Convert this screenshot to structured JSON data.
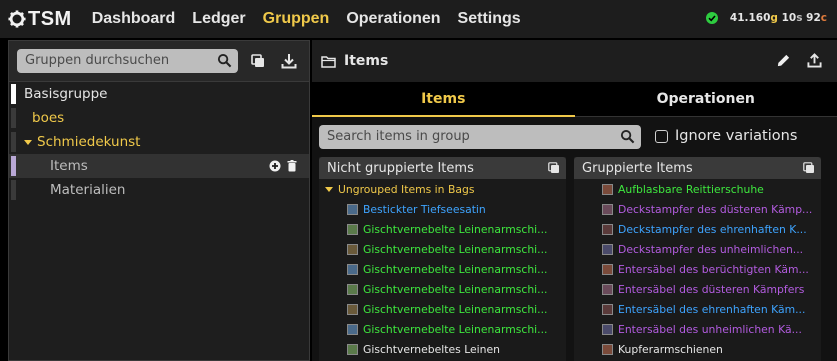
{
  "app": {
    "name": "TSM"
  },
  "nav": [
    {
      "label": "Dashboard",
      "active": false
    },
    {
      "label": "Ledger",
      "active": false
    },
    {
      "label": "Gruppen",
      "active": true
    },
    {
      "label": "Operationen",
      "active": false
    },
    {
      "label": "Settings",
      "active": false
    }
  ],
  "gold": {
    "g": "41.160",
    "g_unit": "g",
    "s": "10",
    "s_unit": "s",
    "c": "92",
    "c_unit": "c"
  },
  "left": {
    "search_placeholder": "Gruppen durchsuchen",
    "tree": [
      {
        "label": "Basisgruppe",
        "color": "#e6e6e6",
        "bar": "#ffffff",
        "indent": 0
      },
      {
        "label": "boes",
        "color": "#f0c94a",
        "bar": "#3a3a3a",
        "indent": 1
      },
      {
        "label": "Schmiedekunst",
        "color": "#f0c94a",
        "bar": "#3a3a3a",
        "indent": 1,
        "expanded": true
      },
      {
        "label": "Items",
        "color": "#bdbdbd",
        "bar": "#b9a8d6",
        "indent": 3,
        "selected": true
      },
      {
        "label": "Materialien",
        "color": "#bdbdbd",
        "bar": "#3a3a3a",
        "indent": 3
      }
    ]
  },
  "right": {
    "title": "Items",
    "tabs": [
      {
        "label": "Items",
        "active": true
      },
      {
        "label": "Operationen",
        "active": false
      }
    ],
    "search_placeholder": "Search items in group",
    "ignore_label": "Ignore variations",
    "ungrouped": {
      "header": "Nicht gruppierte Items",
      "group_label": "Ungrouped Items in Bags",
      "items": [
        {
          "name": "Bestickter Tiefseesatin",
          "color": "#3ea4ff"
        },
        {
          "name": "Gischtvernebelte Leinenarmschi...",
          "color": "#3ee83e"
        },
        {
          "name": "Gischtvernebelte Leinenarmschi...",
          "color": "#3ee83e"
        },
        {
          "name": "Gischtvernebelte Leinenarmschi...",
          "color": "#3ee83e"
        },
        {
          "name": "Gischtvernebelte Leinenarmschi...",
          "color": "#3ee83e"
        },
        {
          "name": "Gischtvernebelte Leinenarmschi...",
          "color": "#3ee83e"
        },
        {
          "name": "Gischtvernebelte Leinenarmschi...",
          "color": "#3ee83e"
        },
        {
          "name": "Gischtvernebeltes Leinen",
          "color": "#e6e6e6"
        }
      ]
    },
    "grouped": {
      "header": "Gruppierte Items",
      "items": [
        {
          "name": "Aufblasbare Reittierschuhe",
          "color": "#3ee83e"
        },
        {
          "name": "Deckstampfer des düsteren Kämp...",
          "color": "#b35ce0"
        },
        {
          "name": "Deckstampfer des ehrenhaften K...",
          "color": "#3ea4ff"
        },
        {
          "name": "Deckstampfer des unheimlichen...",
          "color": "#b35ce0"
        },
        {
          "name": "Entersäbel des berüchtigten Käm...",
          "color": "#b35ce0"
        },
        {
          "name": "Entersäbel des düsteren Kämpfers",
          "color": "#b35ce0"
        },
        {
          "name": "Entersäbel des ehrenhaften Käm...",
          "color": "#3ea4ff"
        },
        {
          "name": "Entersäbel des unheimlichen Kä...",
          "color": "#b35ce0"
        },
        {
          "name": "Kupferarmschienen",
          "color": "#e6e6e6"
        }
      ]
    }
  }
}
